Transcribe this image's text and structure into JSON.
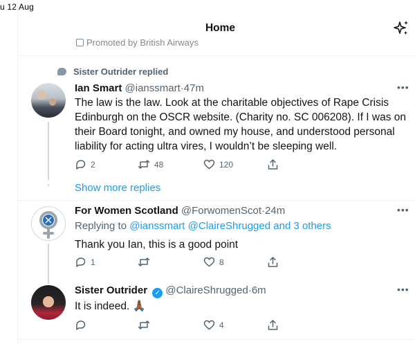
{
  "status_bar": {
    "date": "u 12 Aug"
  },
  "header": {
    "title": "Home"
  },
  "promoted": {
    "text": "Promoted by British Airways"
  },
  "tweets": [
    {
      "context": "Sister Outrider replied",
      "name": "Ian Smart",
      "handle": "@ianssmart",
      "time": "·47m",
      "lines": [
        "The law is the law. Look at the charitable objectives of Rape Crisis",
        "Edinburgh on the OSCR website. (Charity no. SC 006208). If I was on",
        "their Board tonight, and owned my house, and understood personal",
        "liability for acting ultra vires, I wouldn’t be sleeping well."
      ],
      "replies": "2",
      "retweets": "48",
      "likes": "120"
    },
    {
      "name": "For Women Scotland",
      "handle": "@ForwomenScot",
      "time": "·24m",
      "replying_prefix": "Replying to ",
      "replying_to": "@ianssmart @ClaireShrugged and 3 others",
      "text": "Thank you Ian, this is a good point",
      "replies": "1",
      "retweets": "",
      "likes": "8"
    },
    {
      "name": "Sister Outrider",
      "handle": "@ClaireShrugged",
      "time": "·6m",
      "text": "It is indeed. 🙏🏾",
      "replies": "",
      "retweets": "",
      "likes": "4"
    }
  ],
  "show_more": "Show more replies",
  "colors": {
    "accent": "#1d9bf0",
    "muted": "#536471",
    "text": "#0f1419",
    "line": "#cfd9de"
  }
}
